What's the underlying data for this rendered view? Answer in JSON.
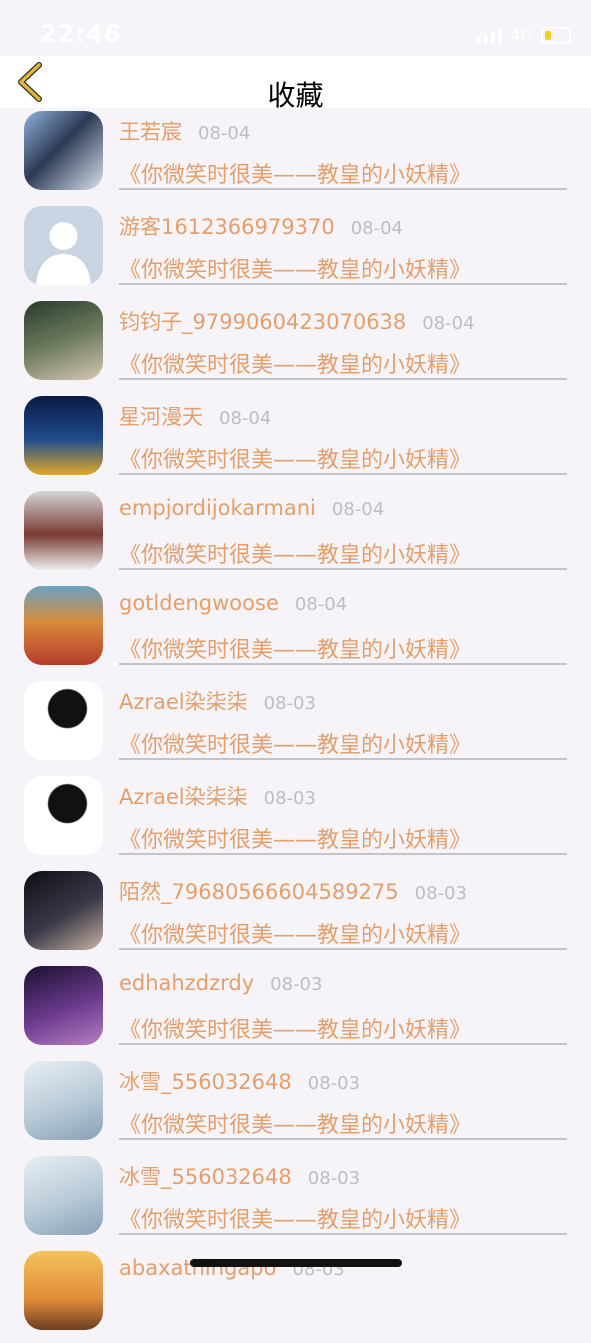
{
  "status_bar": {
    "time": "22:46",
    "network": "4G",
    "battery_color": "#f5d31b"
  },
  "nav": {
    "title": "收藏",
    "back_icon": "chevron-left-icon",
    "back_color": "#e3b63a"
  },
  "favorites": [
    {
      "name": "王若宸",
      "date": "08-04",
      "title": "《你微笑时很美——教皇的小妖精》",
      "avatar": "avatar-phone-photo"
    },
    {
      "name": "游客1612366979370",
      "date": "08-04",
      "title": "《你微笑时很美——教皇的小妖精》",
      "avatar": "avatar-default-person"
    },
    {
      "name": "钧钧子_9799060423070638",
      "date": "08-04",
      "title": "《你微笑时很美——教皇的小妖精》",
      "avatar": "avatar-portrait-photo"
    },
    {
      "name": "星河漫天",
      "date": "08-04",
      "title": "《你微笑时很美——教皇的小妖精》",
      "avatar": "avatar-starry-figure"
    },
    {
      "name": "empjordijokarmani",
      "date": "08-04",
      "title": "《你微笑时很美——教皇的小妖精》",
      "avatar": "avatar-vintage-car"
    },
    {
      "name": "gotldengwoose",
      "date": "08-04",
      "title": "《你微笑时很美——教皇的小妖精》",
      "avatar": "avatar-railway-sunset"
    },
    {
      "name": "Azrael染柒柒",
      "date": "08-03",
      "title": "《你微笑时很美——教皇的小妖精》",
      "avatar": "avatar-cartoon-couple"
    },
    {
      "name": "Azrael染柒柒",
      "date": "08-03",
      "title": "《你微笑时很美——教皇的小妖精》",
      "avatar": "avatar-cartoon-couple"
    },
    {
      "name": "陌然_79680566604589275",
      "date": "08-03",
      "title": "《你微笑时很美——教皇的小妖精》",
      "avatar": "avatar-dark-portrait"
    },
    {
      "name": "edhahzdzrdy",
      "date": "08-03",
      "title": "《你微笑时很美——教皇的小妖精》",
      "avatar": "avatar-purple-galaxy"
    },
    {
      "name": "冰雪_556032648",
      "date": "08-03",
      "title": "《你微笑时很美——教皇的小妖精》",
      "avatar": "avatar-anime-girl"
    },
    {
      "name": "冰雪_556032648",
      "date": "08-03",
      "title": "《你微笑时很美——教皇的小妖精》",
      "avatar": "avatar-anime-girl"
    },
    {
      "name": "abaxathingapo",
      "date": "08-03",
      "title": "",
      "avatar": "avatar-sunset"
    }
  ]
}
